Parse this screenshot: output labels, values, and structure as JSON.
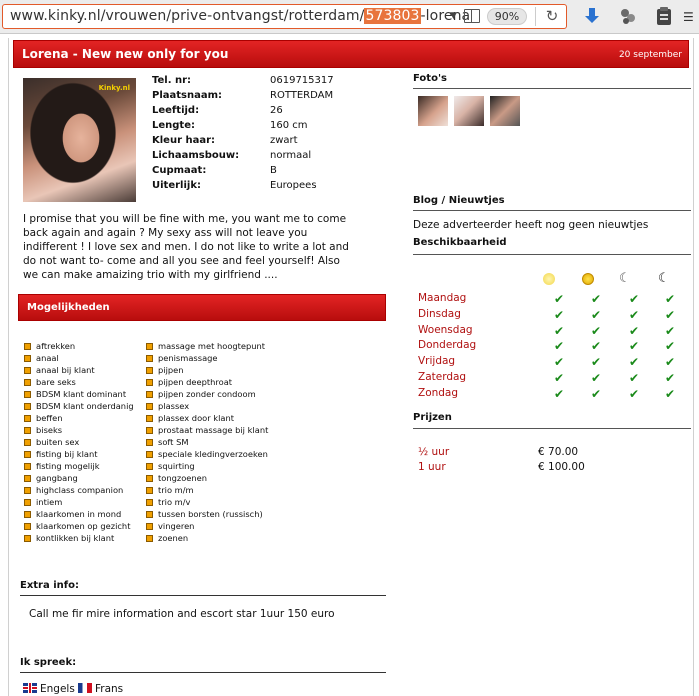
{
  "browser": {
    "url_prefix": "www.kinky.nl/vrouwen/prive-ontvangst/rotterdam/",
    "url_highlight": "573803",
    "url_suffix": "-lorena",
    "zoom": "90%"
  },
  "listing": {
    "title": "Lorena - New new only for you",
    "date": "20 september",
    "photo_watermark": "Kinky.nl"
  },
  "facts": [
    {
      "label": "Tel. nr:",
      "value": "0619715317"
    },
    {
      "label": "Plaatsnaam:",
      "value": "ROTTERDAM"
    },
    {
      "label": "Leeftijd:",
      "value": "26"
    },
    {
      "label": "Lengte:",
      "value": "160 cm"
    },
    {
      "label": "Kleur haar:",
      "value": "zwart"
    },
    {
      "label": "Lichaamsbouw:",
      "value": "normaal"
    },
    {
      "label": "Cupmaat:",
      "value": "B"
    },
    {
      "label": "Uiterlijk:",
      "value": "Europees"
    }
  ],
  "description": "I promise that you will be fine with me, you want me to come back again and again ? My sexy ass will not leave you indifferent ! I love sex and men. I do not like to write a lot and do not want to- come and all you see and feel yourself! Also we can make amaizing trio with my girlfriend ....",
  "options": {
    "heading": "Mogelijkheden",
    "col1": [
      "aftrekken",
      "anaal",
      "anaal bij klant",
      "bare seks",
      "BDSM klant dominant",
      "BDSM klant onderdanig",
      "beffen",
      "biseks",
      "buiten sex",
      "fisting bij klant",
      "fisting mogelijk",
      "gangbang",
      "highclass companion",
      "intiem",
      "klaarkomen in mond",
      "klaarkomen op gezicht",
      "kontlikken bij klant"
    ],
    "col2": [
      "massage met hoogtepunt",
      "penismassage",
      "pijpen",
      "pijpen deepthroat",
      "pijpen zonder condoom",
      "plassex",
      "plassex door klant",
      "prostaat massage bij klant",
      "soft SM",
      "speciale kledingverzoeken",
      "squirting",
      "tongzoenen",
      "trio m/m",
      "trio m/v",
      "tussen borsten (russisch)",
      "vingeren",
      "zoenen"
    ]
  },
  "extra": {
    "heading": "Extra info:",
    "text": "Call me fir mire information and escort star 1uur 150 euro"
  },
  "languages": {
    "heading": "Ik spreek:",
    "items": [
      "Engels",
      "Frans"
    ]
  },
  "photos": {
    "heading": "Foto's",
    "count": 3
  },
  "blog": {
    "heading": "Blog / Nieuwtjes",
    "text": "Deze adverteerder heeft nog geen nieuwtjes"
  },
  "availability": {
    "heading": "Beschikbaarheid",
    "days": [
      "Maandag",
      "Dinsdag",
      "Woensdag",
      "Donderdag",
      "Vrijdag",
      "Zaterdag",
      "Zondag"
    ],
    "check_mark": "✔"
  },
  "prices": {
    "heading": "Prijzen",
    "items": [
      {
        "unit": "½  uur",
        "price": "€ 70.00"
      },
      {
        "unit": "1   uur",
        "price": "€ 100.00"
      }
    ]
  },
  "colors": {
    "brand_red": "#c41414",
    "day_red": "#b01010",
    "check_green": "#1a8a1a",
    "bullet_orange": "#f0a000"
  }
}
